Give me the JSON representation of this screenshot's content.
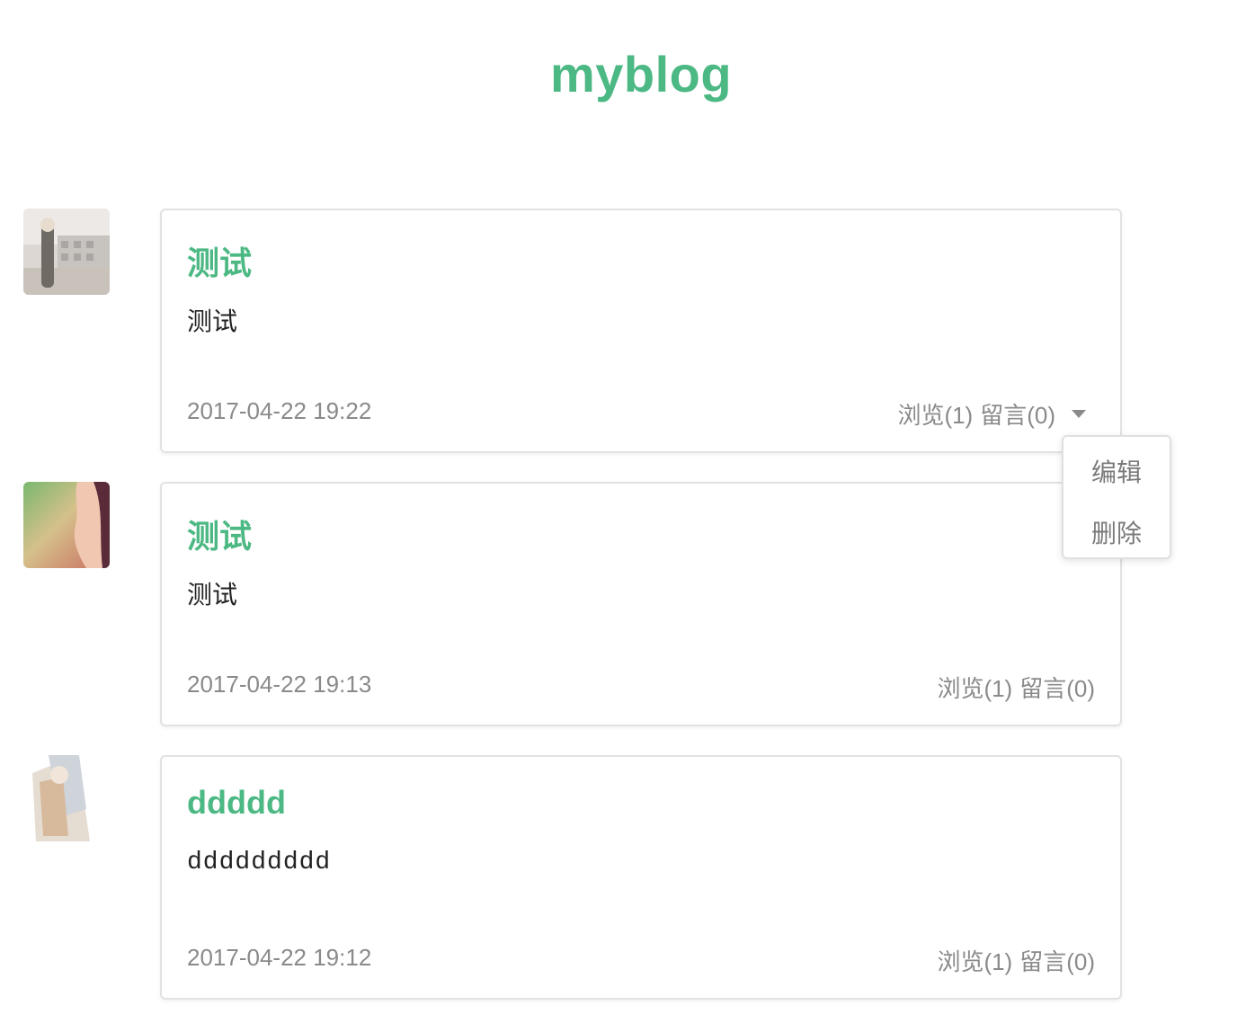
{
  "header": {
    "title": "myblog"
  },
  "posts": [
    {
      "title": "测试",
      "content": "测试",
      "date": "2017-04-22 19:22",
      "views": "浏览(1)",
      "comments": "留言(0)"
    },
    {
      "title": "测试",
      "content": "测试",
      "date": "2017-04-22 19:13",
      "views": "浏览(1)",
      "comments": "留言(0)"
    },
    {
      "title": "ddddd",
      "content": "ddddddddd",
      "date": "2017-04-22 19:12",
      "views": "浏览(1)",
      "comments": "留言(0)"
    }
  ],
  "dropdown": {
    "items": [
      "编辑",
      "删除"
    ]
  },
  "icons": {
    "dropdown": "caret-down-icon"
  },
  "colors": {
    "accent": "#4cb883",
    "meta": "#8a8a8a",
    "border": "#e2e2e2"
  }
}
